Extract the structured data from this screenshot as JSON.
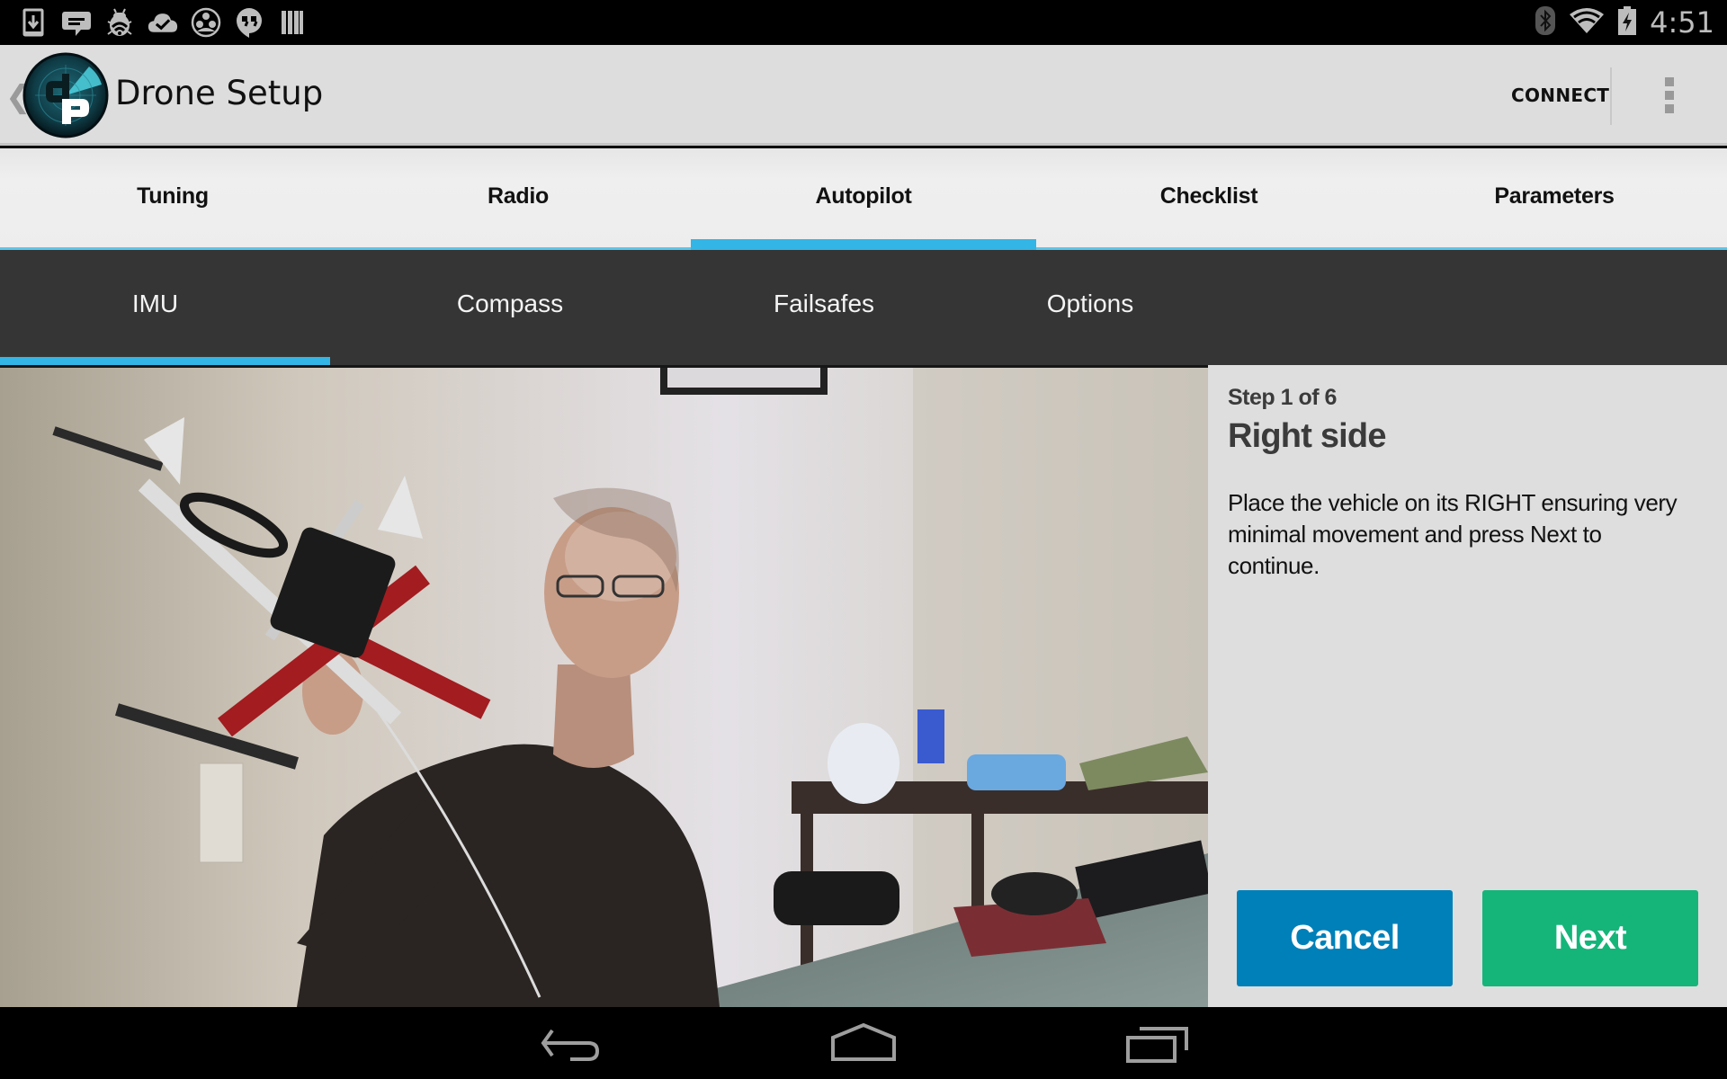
{
  "status_bar": {
    "left_icons": [
      "download-icon",
      "sms-icon",
      "debug-bug-icon",
      "cloud-check-icon",
      "circles-icon",
      "hangouts-icon",
      "barcode-icon"
    ],
    "right_icons": [
      "bluetooth-icon",
      "wifi-icon",
      "battery-charging-icon"
    ],
    "time": "4:51"
  },
  "action_bar": {
    "title": "Drone Setup",
    "connect_label": "CONNECT",
    "overflow_icon": "overflow-menu-icon",
    "logo": "droidplanner-logo"
  },
  "top_tabs": {
    "active_index": 2,
    "items": [
      {
        "label": "Tuning"
      },
      {
        "label": "Radio"
      },
      {
        "label": "Autopilot"
      },
      {
        "label": "Checklist"
      },
      {
        "label": "Parameters"
      }
    ]
  },
  "sub_tabs": {
    "active_index": 0,
    "items": [
      {
        "label": "IMU"
      },
      {
        "label": "Compass"
      },
      {
        "label": "Failsafes"
      },
      {
        "label": "Options"
      }
    ]
  },
  "calibration": {
    "step_text": "Step 1 of 6",
    "title": "Right side",
    "description": "Place the vehicle on its RIGHT ensuring very minimal movement and press Next to continue.",
    "cancel_label": "Cancel",
    "next_label": "Next"
  },
  "video": {
    "description": "Instruction video: man holding a quadcopter drone on its right side"
  },
  "colors": {
    "accent": "#33b5e5",
    "cancel_button": "#0080b8",
    "next_button": "#15b57a",
    "sub_tab_bar": "#353535",
    "action_bar": "#dddddd"
  },
  "nav_bar": {
    "buttons": [
      "back-icon",
      "home-icon",
      "recents-icon"
    ]
  }
}
